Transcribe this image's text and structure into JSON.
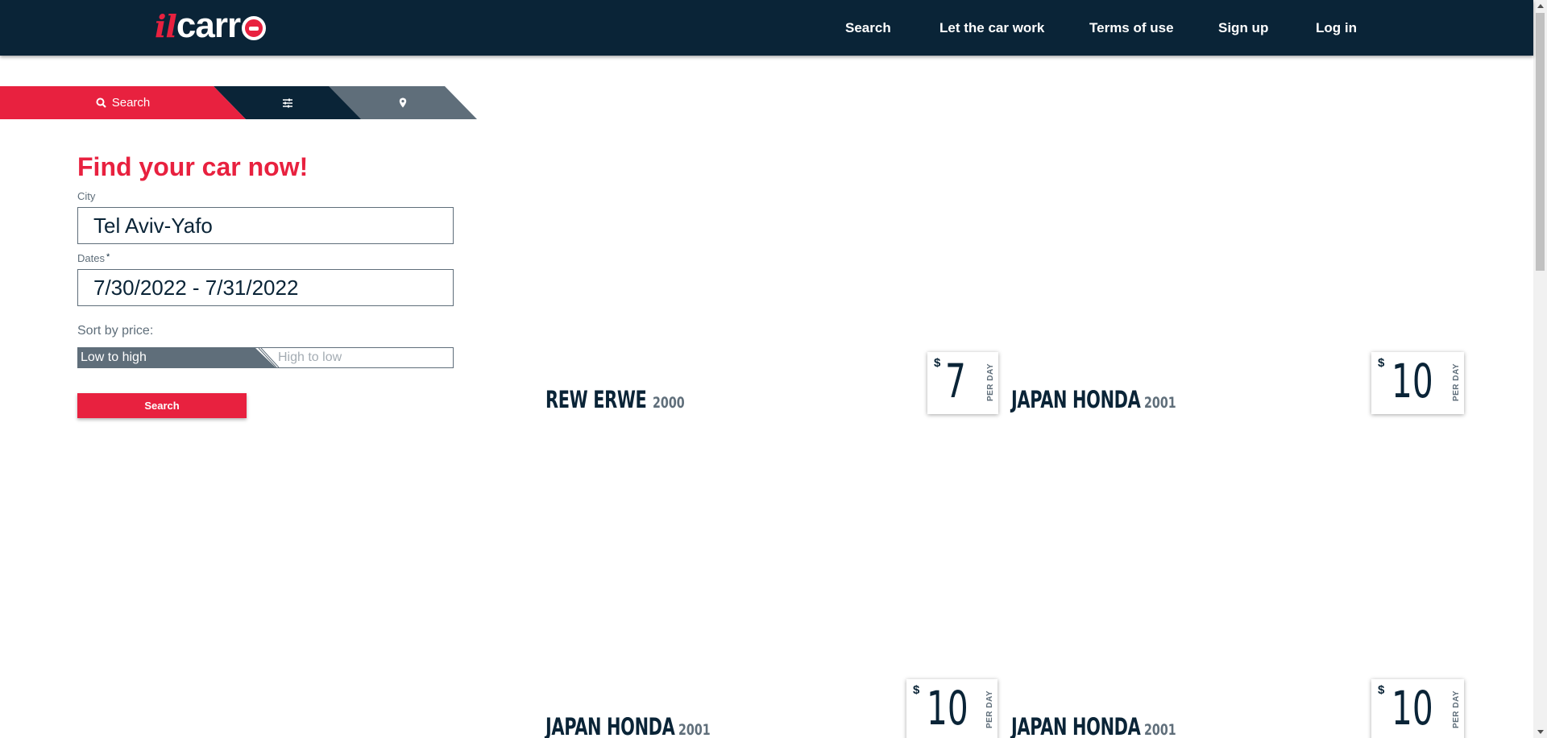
{
  "header": {
    "logo_il": "il",
    "logo_carr": "carr",
    "nav": [
      "Search",
      "Let the car work",
      "Terms of use",
      "Sign up",
      "Log in"
    ]
  },
  "tabs": {
    "search_label": "Search",
    "filter_icon": "sliders-icon",
    "location_icon": "map-marker-icon"
  },
  "form": {
    "title": "Find your car now!",
    "city_label": "City",
    "city_value": "Tel Aviv-Yafo",
    "dates_label": "Dates",
    "dates_required": "*",
    "dates_value": "7/30/2022 - 7/31/2022",
    "sort_label": "Sort by price:",
    "sort_low": "Low to high",
    "sort_high": "High to low",
    "search_button": "Search"
  },
  "cars": [
    {
      "name": "REW ERWE",
      "year": "2000",
      "currency": "$",
      "price": "7",
      "per": "PER DAY"
    },
    {
      "name": "JAPAN HONDA",
      "year": "2001",
      "currency": "$",
      "price": "10",
      "per": "PER DAY"
    },
    {
      "name": "JAPAN HONDA",
      "year": "2001",
      "currency": "$",
      "price": "10",
      "per": "PER DAY"
    },
    {
      "name": "JAPAN HONDA",
      "year": "2001",
      "currency": "$",
      "price": "10",
      "per": "PER DAY"
    }
  ],
  "colors": {
    "brand_red": "#e8213f",
    "navy": "#0a2437",
    "slate": "#5f6e7a"
  }
}
